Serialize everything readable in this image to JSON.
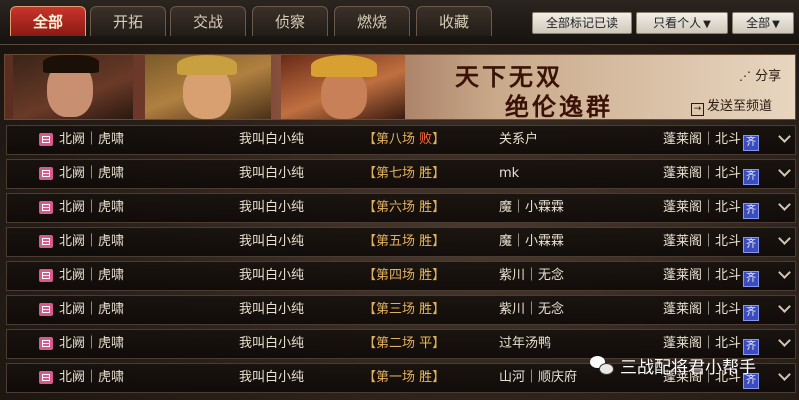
{
  "tabs": [
    {
      "label": "全部",
      "active": true
    },
    {
      "label": "开拓",
      "active": false
    },
    {
      "label": "交战",
      "active": false
    },
    {
      "label": "侦察",
      "active": false
    },
    {
      "label": "燃烧",
      "active": false
    },
    {
      "label": "收藏",
      "active": false
    }
  ],
  "toolbar": {
    "mark_all_read": "全部标记已读",
    "filter_personal": "只看个人",
    "filter_all": "全部"
  },
  "banner": {
    "line1": "天下无双",
    "line2": "绝伦逸群",
    "share": "分享",
    "send_to_channel": "发送至频道"
  },
  "reports": [
    {
      "location": "北阙｜虎啸",
      "player": "我叫白小纯",
      "battle": "【第八场 ",
      "result": "败",
      "result_type": "lose",
      "close": "】",
      "opponent": "关系户",
      "server": "蓬莱阁｜北斗",
      "tag": "齐"
    },
    {
      "location": "北阙｜虎啸",
      "player": "我叫白小纯",
      "battle": "【第七场 ",
      "result": "胜",
      "result_type": "win",
      "close": "】",
      "opponent": "mk",
      "server": "蓬莱阁｜北斗",
      "tag": "齐"
    },
    {
      "location": "北阙｜虎啸",
      "player": "我叫白小纯",
      "battle": "【第六场 ",
      "result": "胜",
      "result_type": "win",
      "close": "】",
      "opponent": "魔｜小霖霖",
      "server": "蓬莱阁｜北斗",
      "tag": "齐"
    },
    {
      "location": "北阙｜虎啸",
      "player": "我叫白小纯",
      "battle": "【第五场 ",
      "result": "胜",
      "result_type": "win",
      "close": "】",
      "opponent": "魔｜小霖霖",
      "server": "蓬莱阁｜北斗",
      "tag": "齐"
    },
    {
      "location": "北阙｜虎啸",
      "player": "我叫白小纯",
      "battle": "【第四场 ",
      "result": "胜",
      "result_type": "win",
      "close": "】",
      "opponent": "紫川｜无念",
      "server": "蓬莱阁｜北斗",
      "tag": "齐"
    },
    {
      "location": "北阙｜虎啸",
      "player": "我叫白小纯",
      "battle": "【第三场 ",
      "result": "胜",
      "result_type": "win",
      "close": "】",
      "opponent": "紫川｜无念",
      "server": "蓬莱阁｜北斗",
      "tag": "齐"
    },
    {
      "location": "北阙｜虎啸",
      "player": "我叫白小纯",
      "battle": "【第二场 ",
      "result": "平",
      "result_type": "draw",
      "close": "】",
      "opponent": "过年汤鸭",
      "server": "蓬莱阁｜北斗",
      "tag": "齐"
    },
    {
      "location": "北阙｜虎啸",
      "player": "我叫白小纯",
      "battle": "【第一场 ",
      "result": "胜",
      "result_type": "win",
      "close": "】",
      "opponent": "山河｜顺庆府",
      "server": "蓬莱阁｜北斗",
      "tag": "齐"
    }
  ],
  "watermark": "三战配将君小帮手",
  "colors": {
    "accent": "#c9342c",
    "win": "#f0c050",
    "lose": "#ff6a3a"
  }
}
